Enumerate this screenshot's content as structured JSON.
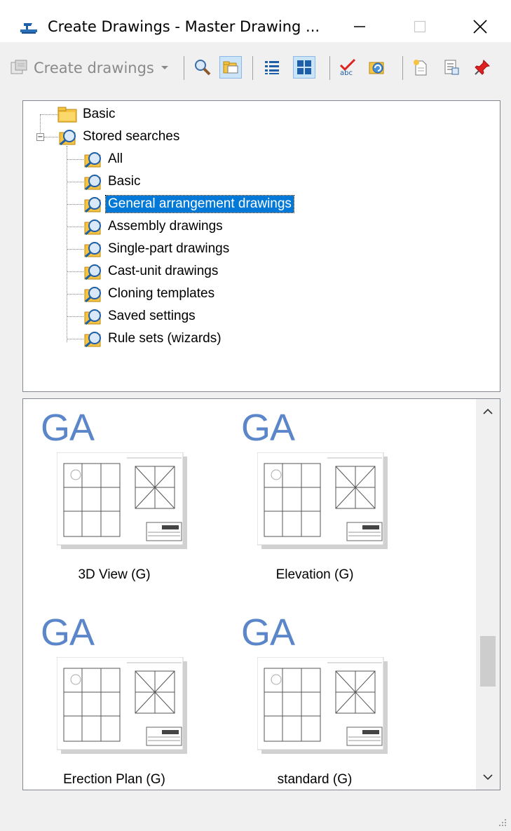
{
  "window": {
    "title": "Create Drawings - Master Drawing ...",
    "icon": "tekla-app-icon"
  },
  "toolbar": {
    "create_label": "Create drawings",
    "buttons": [
      "search-icon",
      "folder-view-icon",
      "list-view-icon",
      "thumbnail-view-icon",
      "spellcheck-icon",
      "refresh-icon",
      "new-icon",
      "properties-icon",
      "pin-icon"
    ]
  },
  "tree": {
    "root_items": [
      {
        "label": "Basic",
        "icon": "folder-icon"
      },
      {
        "label": "Stored searches",
        "icon": "stored-search-icon",
        "expanded": true
      }
    ],
    "children": [
      {
        "label": "All"
      },
      {
        "label": "Basic"
      },
      {
        "label": "General arrangement drawings",
        "selected": true
      },
      {
        "label": "Assembly drawings"
      },
      {
        "label": "Single-part drawings"
      },
      {
        "label": "Cast-unit drawings"
      },
      {
        "label": "Cloning templates"
      },
      {
        "label": "Saved settings"
      },
      {
        "label": "Rule sets (wizards)"
      }
    ]
  },
  "thumbnails": [
    {
      "badge": "GA",
      "caption": "3D View (G)"
    },
    {
      "badge": "GA",
      "caption": "Elevation (G)"
    },
    {
      "badge": "GA",
      "caption": "Erection Plan (G)"
    },
    {
      "badge": "GA",
      "caption": "standard (G)"
    }
  ],
  "colors": {
    "selection": "#0078d7",
    "ga_badge": "#5b86c9"
  }
}
